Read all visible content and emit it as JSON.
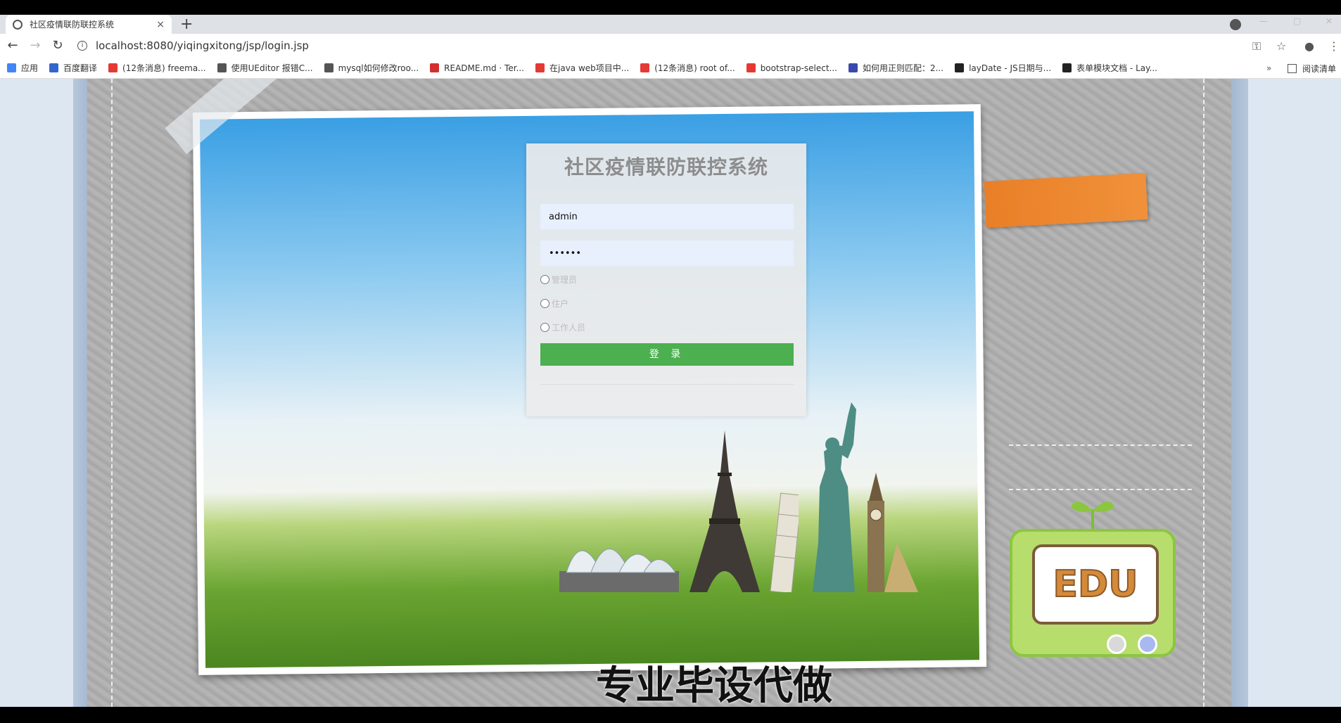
{
  "browser": {
    "tab_title": "社区疫情联防联控系统",
    "tab_close": "×",
    "new_tab": "+",
    "url": "localhost:8080/yiqingxitong/jsp/login.jsp",
    "reading_list": "阅读清单",
    "more_bookmarks": "»"
  },
  "bookmarks": [
    {
      "label": "应用",
      "color": "#4285f4"
    },
    {
      "label": "百度翻译",
      "color": "#3366cc"
    },
    {
      "label": "(12条消息) freema...",
      "color": "#e53935"
    },
    {
      "label": "使用UEditor 报错C...",
      "color": "#555555"
    },
    {
      "label": "mysql如何修改roo...",
      "color": "#555555"
    },
    {
      "label": "README.md · Ter...",
      "color": "#d32f2f"
    },
    {
      "label": "在java web项目中...",
      "color": "#e53935"
    },
    {
      "label": "(12条消息) root of...",
      "color": "#e53935"
    },
    {
      "label": "bootstrap-select...",
      "color": "#e53935"
    },
    {
      "label": "如何用正则匹配：2...",
      "color": "#3949ab"
    },
    {
      "label": "layDate - JS日期与...",
      "color": "#222222"
    },
    {
      "label": "表单模块文档 - Lay...",
      "color": "#222222"
    }
  ],
  "login": {
    "title": "社区疫情联防联控系统",
    "username_value": "admin",
    "password_value": "••••••",
    "roles": [
      "管理员",
      "住户",
      "工作人员"
    ],
    "submit_label": "登 录"
  },
  "decor": {
    "edu_label": "EDU",
    "caption": "专业毕设代做"
  },
  "colors": {
    "login_button": "#4caf50",
    "input_bg": "#e8f0fe",
    "orange_tag": "#e97f27",
    "edu_green": "#b7dd6d"
  }
}
